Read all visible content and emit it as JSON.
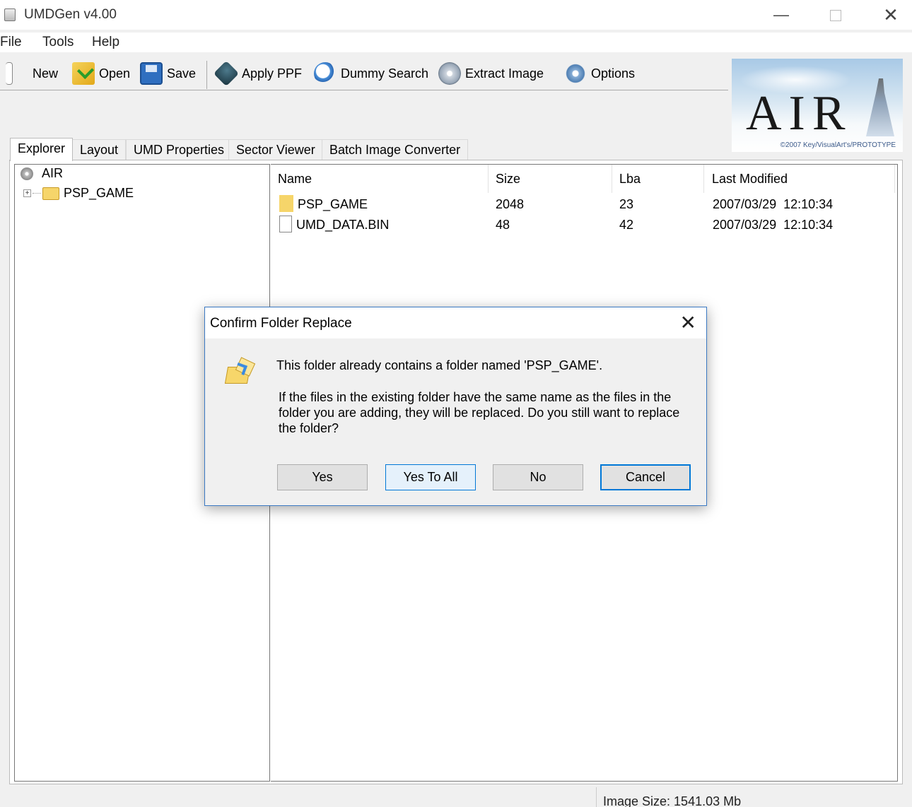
{
  "window": {
    "title": "UMDGen v4.00",
    "minimize": "—",
    "close": "✕"
  },
  "menu": [
    "File",
    "Tools",
    "Help"
  ],
  "toolbar": {
    "new": "New",
    "open": "Open",
    "save": "Save",
    "apply_ppf": "Apply PPF",
    "dummy_search": "Dummy Search",
    "extract_image": "Extract Image",
    "options": "Options"
  },
  "logo": {
    "text": "AIR",
    "copyright": "©2007 Key/VisualArt's/PROTOTYPE"
  },
  "tabs": [
    "Explorer",
    "Layout",
    "UMD Properties",
    "Sector Viewer",
    "Batch Image Converter"
  ],
  "tree": {
    "root": "AIR",
    "child": "PSP_GAME",
    "expander": "+"
  },
  "list": {
    "columns": [
      "Name",
      "Size",
      "Lba",
      "Last Modified"
    ],
    "rows": [
      {
        "name": "PSP_GAME",
        "size": "2048",
        "lba": "23",
        "modified": "2007/03/29  12:10:34",
        "kind": "folder"
      },
      {
        "name": "UMD_DATA.BIN",
        "size": "48",
        "lba": "42",
        "modified": "2007/03/29  12:10:34",
        "kind": "file"
      }
    ]
  },
  "status": {
    "image_size": "Image Size: 1541.03 Mb"
  },
  "dialog": {
    "title": "Confirm Folder Replace",
    "close": "✕",
    "message1": "This folder already contains a folder named 'PSP_GAME'.",
    "message2": "If the files in the existing folder have the same name as the files in the folder you are adding, they will be replaced. Do you still want to replace the folder?",
    "buttons": {
      "yes": "Yes",
      "yes_to_all": "Yes To All",
      "no": "No",
      "cancel": "Cancel"
    }
  }
}
